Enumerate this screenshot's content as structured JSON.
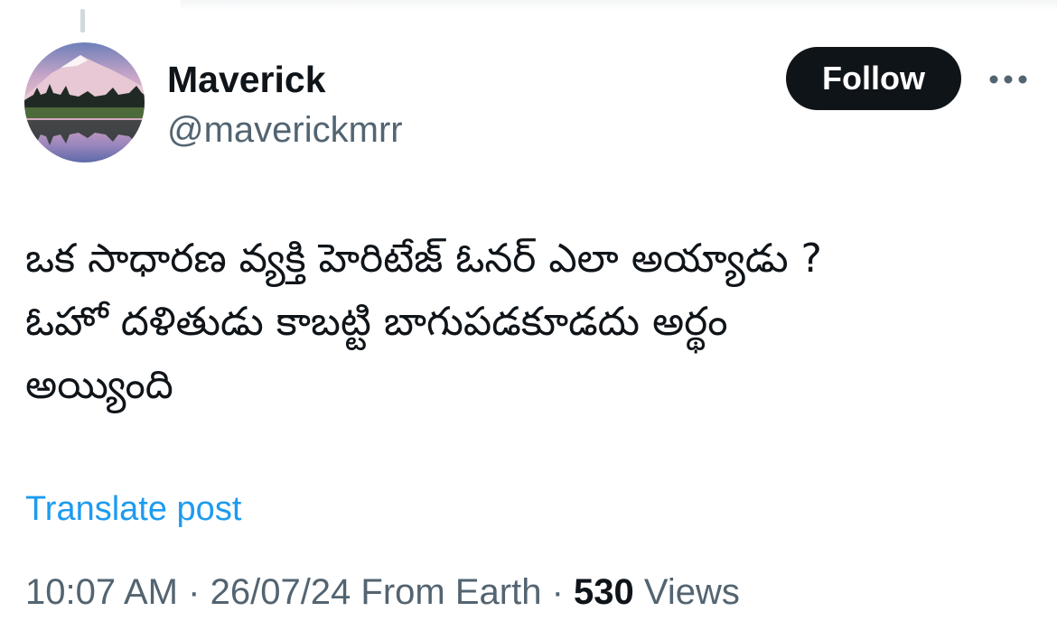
{
  "author": {
    "display_name": "Maverick",
    "handle": "@maverickmrr",
    "avatar_icon": "mountain-lake-avatar"
  },
  "actions": {
    "follow_label": "Follow",
    "more_icon": "more-horizontal-icon"
  },
  "post": {
    "lines": [
      "ఒక సాధారణ వ్యక్తి హెరిటేజ్ ఓనర్ ఎలా అయ్యాడు ?",
      "ఓహో దళితుడు కాబట్టి బాగుపడకూడదు అర్థం",
      "అయ్యింది"
    ],
    "translate_label": "Translate post"
  },
  "meta": {
    "time": "10:07 AM",
    "separator": "·",
    "date": "26/07/24",
    "source": "From Earth",
    "views_count": "530",
    "views_label": "Views"
  },
  "colors": {
    "text_primary": "#0f1419",
    "text_secondary": "#536471",
    "link": "#1d9bf0",
    "button_bg": "#0f1419"
  }
}
